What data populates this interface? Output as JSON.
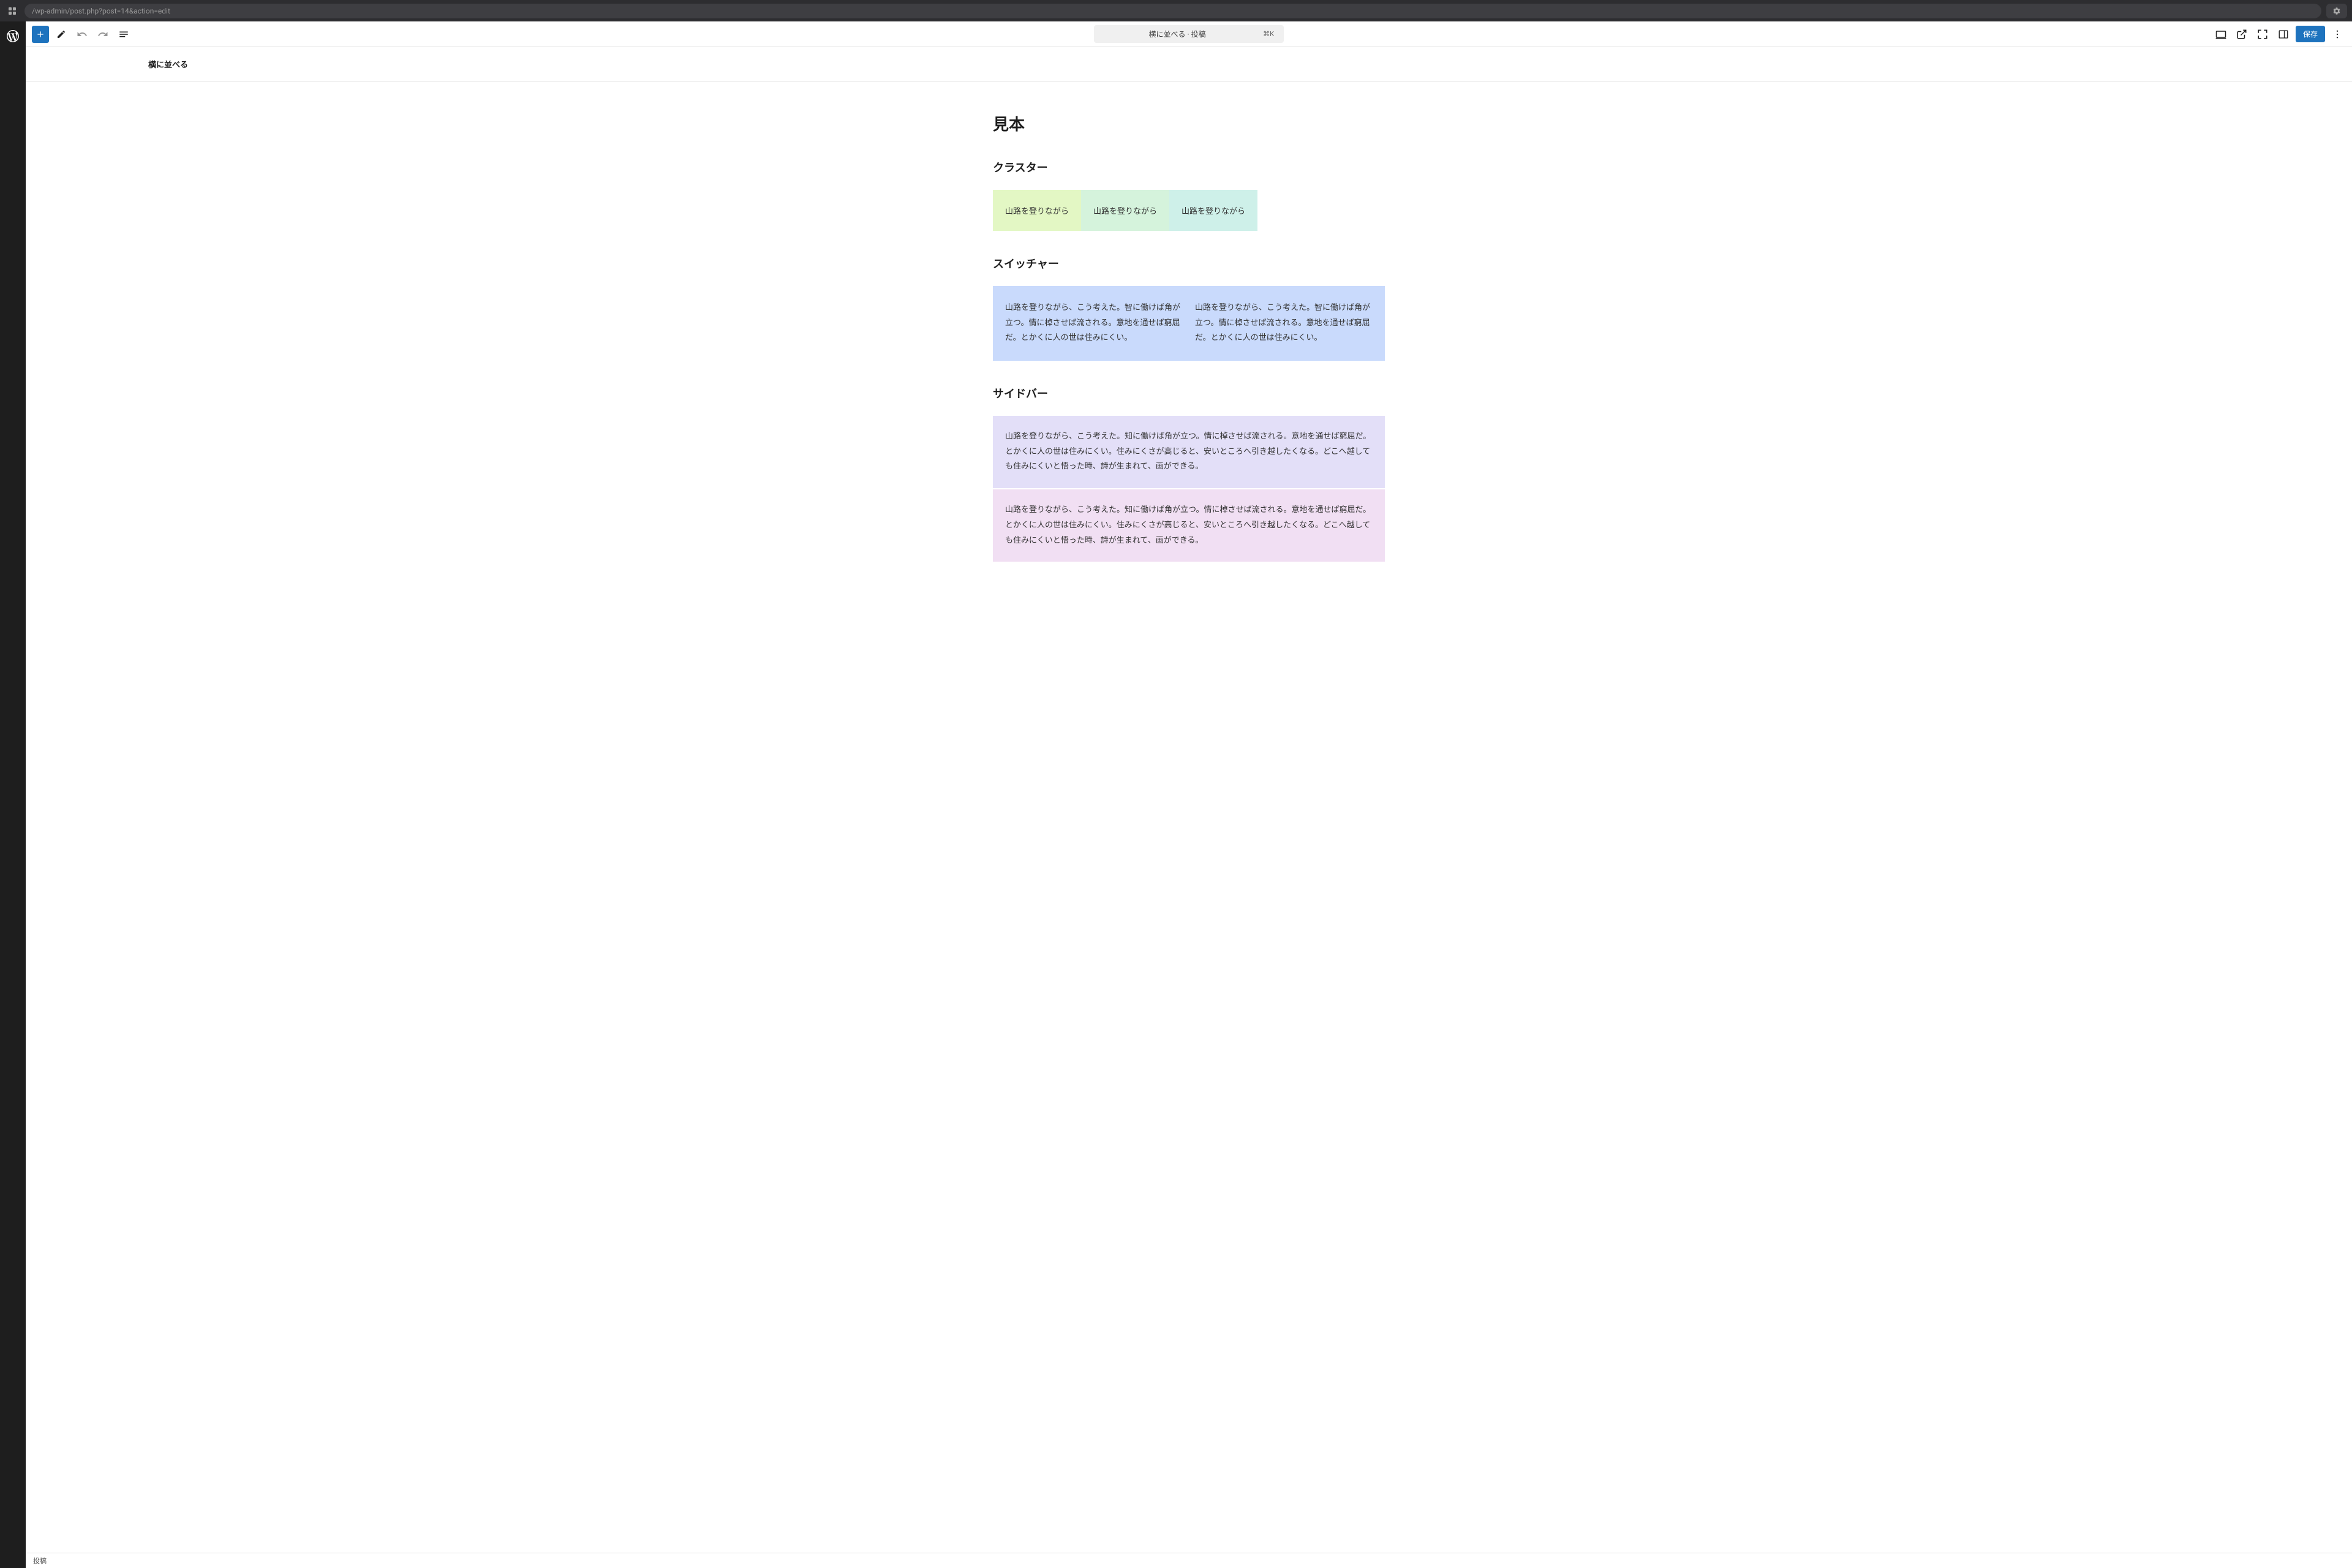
{
  "browser": {
    "url": "/wp-admin/post.php?post=14&action=edit"
  },
  "toolbar": {
    "doc_title": "横に並べる · 投稿",
    "shortcut": "⌘K",
    "save_label": "保存"
  },
  "header": {
    "page_tab": "横に並べる"
  },
  "content": {
    "h1": "見本",
    "section1": {
      "title": "クラスター",
      "items": [
        "山路を登りながら",
        "山路を登りながら",
        "山路を登りながら"
      ]
    },
    "section2": {
      "title": "スイッチャー",
      "cols": [
        "山路を登りながら、こう考えた。智に働けば角が立つ。情に棹させば流される。意地を通せば窮屈だ。とかくに人の世は住みにくい。",
        "山路を登りながら、こう考えた。智に働けば角が立つ。情に棹させば流される。意地を通せば窮屈だ。とかくに人の世は住みにくい。"
      ]
    },
    "section3": {
      "title": "サイドバー",
      "blocks": [
        "山路を登りながら、こう考えた。知に働けば角が立つ。情に棹させば流される。意地を通せば窮屈だ。とかくに人の世は住みにくい。住みにくさが高じると、安いところへ引き越したくなる。どこへ越しても住みにくいと悟った時、詩が生まれて、画ができる。",
        "山路を登りながら、こう考えた。知に働けば角が立つ。情に棹させば流される。意地を通せば窮屈だ。とかくに人の世は住みにくい。住みにくさが高じると、安いところへ引き越したくなる。どこへ越しても住みにくいと悟った時、詩が生まれて、画ができる。"
      ]
    }
  },
  "footer": {
    "label": "投稿"
  }
}
